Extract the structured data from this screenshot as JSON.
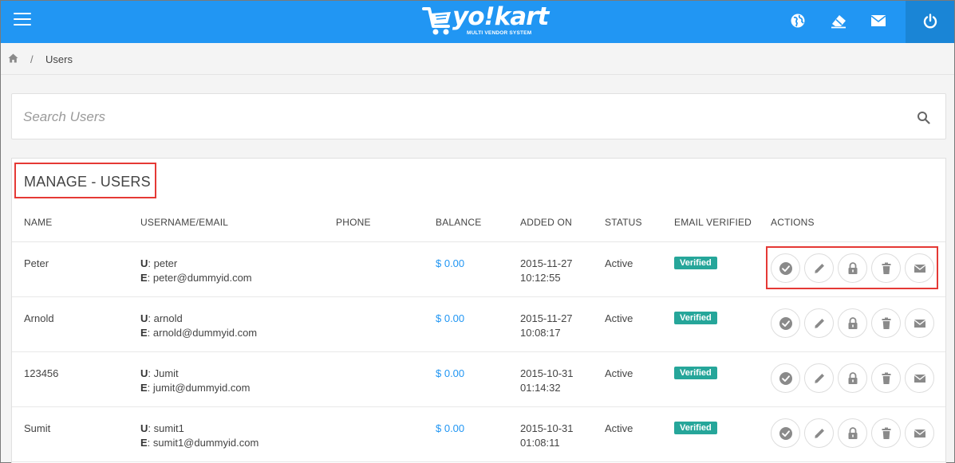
{
  "app": {
    "logo_text": "yo!kart",
    "logo_tagline": "MULTI VENDOR SYSTEM"
  },
  "topbar_icons": [
    "menu-icon",
    "globe-icon",
    "eraser-icon",
    "mail-icon",
    "power-icon"
  ],
  "breadcrumb": {
    "current": "Users",
    "separator": "/"
  },
  "search": {
    "placeholder": "Search Users",
    "value": ""
  },
  "panel": {
    "title": "MANAGE - USERS",
    "columns": [
      "NAME",
      "USERNAME/EMAIL",
      "PHONE",
      "BALANCE",
      "ADDED ON",
      "STATUS",
      "EMAIL VERIFIED",
      "ACTIONS"
    ]
  },
  "labels": {
    "username_prefix": "U",
    "email_prefix": "E"
  },
  "users": [
    {
      "name": "Peter",
      "username": ": peter",
      "email": ": peter@dummyid.com",
      "phone": "",
      "balance": "$ 0.00",
      "added_date": "2015-11-27",
      "added_time": "10:12:55",
      "status": "Active",
      "email_verified": "Verified"
    },
    {
      "name": "Arnold",
      "username": ": arnold",
      "email": ": arnold@dummyid.com",
      "phone": "",
      "balance": "$ 0.00",
      "added_date": "2015-11-27",
      "added_time": "10:08:17",
      "status": "Active",
      "email_verified": "Verified"
    },
    {
      "name": "123456",
      "username": ": Jumit",
      "email": ": jumit@dummyid.com",
      "phone": "",
      "balance": "$ 0.00",
      "added_date": "2015-10-31",
      "added_time": "01:14:32",
      "status": "Active",
      "email_verified": "Verified"
    },
    {
      "name": "Sumit",
      "username": ": sumit1",
      "email": ": sumit1@dummyid.com",
      "phone": "",
      "balance": "$ 0.00",
      "added_date": "2015-10-31",
      "added_time": "01:08:11",
      "status": "Active",
      "email_verified": "Verified"
    }
  ],
  "row_actions": [
    "check-icon",
    "pencil-icon",
    "lock-icon",
    "trash-icon",
    "mail-icon"
  ],
  "colors": {
    "brand": "#2196f3",
    "verified_badge": "#26a69a",
    "highlight": "#e53935",
    "balance_link": "#2196f3"
  }
}
